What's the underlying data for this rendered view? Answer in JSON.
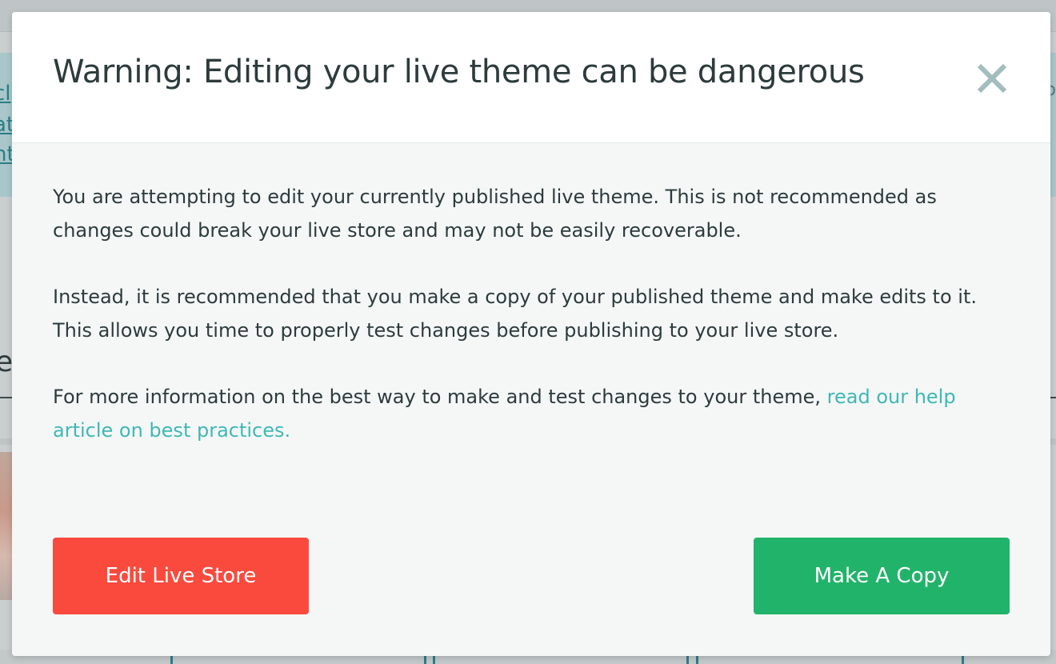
{
  "background": {
    "banner_links": [
      "cl",
      "at",
      "nt"
    ],
    "heading_fragment": "es",
    "right_glyph": "o"
  },
  "modal": {
    "title": "Warning: Editing your live theme can be dangerous",
    "close_icon": "close-icon",
    "paragraphs": [
      "You are attempting to edit your currently published live theme. This is not recommended as changes could break your live store and may not be easily recoverable.",
      "Instead, it is recommended that you make a copy of your published theme and make edits to it. This allows you time to properly test changes before publishing to your live store."
    ],
    "info_text": "For more information on the best way to make and test changes to your theme, ",
    "help_link_text": "read our help article on best practices.",
    "buttons": {
      "edit_live_label": "Edit Live Store",
      "make_copy_label": "Make A Copy"
    }
  },
  "colors": {
    "danger": "#fa4a3d",
    "primary": "#22b36a",
    "link": "#3fb8b5",
    "text": "#2d3b3c"
  }
}
